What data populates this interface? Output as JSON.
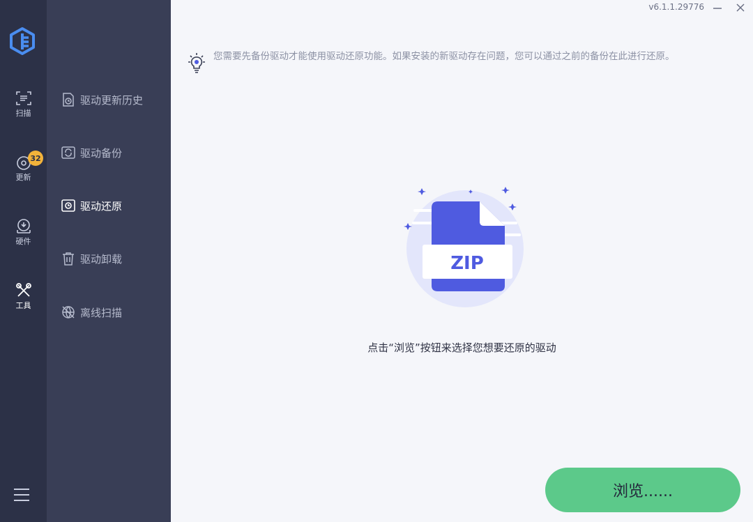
{
  "app": {
    "version": "v6.1.1.29776"
  },
  "rail": {
    "items": [
      {
        "label": "扫描",
        "icon": "scan-icon"
      },
      {
        "label": "更新",
        "icon": "update-icon",
        "badge": "32"
      },
      {
        "label": "硬件",
        "icon": "hardware-icon"
      },
      {
        "label": "工具",
        "icon": "tools-icon"
      }
    ]
  },
  "subnav": {
    "items": [
      {
        "label": "驱动更新历史",
        "icon": "history-icon"
      },
      {
        "label": "驱动备份",
        "icon": "backup-icon"
      },
      {
        "label": "驱动还原",
        "icon": "restore-icon",
        "active": true
      },
      {
        "label": "驱动卸载",
        "icon": "trash-icon"
      },
      {
        "label": "离线扫描",
        "icon": "offline-scan-icon"
      }
    ]
  },
  "main": {
    "tip": "您需要先备份驱动才能使用驱动还原功能。如果安装的新驱动存在问题，您可以通过之前的备份在此进行还原。",
    "illustration_label": "ZIP",
    "hint": "点击“浏览”按钮来选择您想要还原的驱动",
    "browse_label": "浏览......"
  },
  "colors": {
    "rail_bg": "#2c3147",
    "subnav_bg": "#393e56",
    "main_bg": "#f5f6fa",
    "accent_blue": "#4f5be0",
    "button_green": "#5cc98a",
    "badge": "#f3b33a"
  }
}
